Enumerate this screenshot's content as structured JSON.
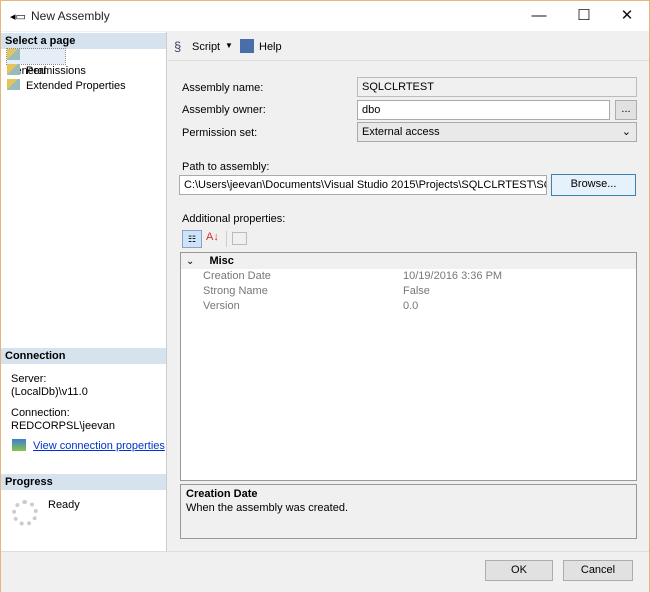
{
  "window": {
    "title": "New Assembly",
    "minimize": "—",
    "maximize": "☐",
    "close": "✕"
  },
  "left": {
    "select_header": "Select a page",
    "pages": [
      {
        "label": "General"
      },
      {
        "label": "Permissions"
      },
      {
        "label": "Extended Properties"
      }
    ],
    "connection_header": "Connection",
    "server_label": "Server:",
    "server_value": "(LocalDb)\\v11.0",
    "connection_label": "Connection:",
    "connection_value": "REDCORPSL\\jeevan",
    "view_link": "View connection properties",
    "progress_header": "Progress",
    "progress_status": "Ready"
  },
  "toolbar": {
    "script": "Script",
    "help": "Help"
  },
  "form": {
    "assembly_name_label": "Assembly name:",
    "assembly_name": "SQLCLRTEST",
    "assembly_owner_label": "Assembly owner:",
    "assembly_owner": "dbo",
    "browse_owner": "...",
    "permission_label": "Permission set:",
    "permission_value": "External access",
    "path_label": "Path to assembly:",
    "path_value": "C:\\Users\\jeevan\\Documents\\Visual Studio 2015\\Projects\\SQLCLRTEST\\SQLCLRTEST\\bin",
    "browse": "Browse...",
    "additional_label": "Additional properties:"
  },
  "grid": {
    "category": "Misc",
    "rows": [
      {
        "name": "Creation Date",
        "value": "10/19/2016 3:36 PM"
      },
      {
        "name": "Strong Name",
        "value": "False"
      },
      {
        "name": "Version",
        "value": "0.0"
      }
    ]
  },
  "description": {
    "title": "Creation Date",
    "text": "When the assembly was created."
  },
  "buttons": {
    "ok": "OK",
    "cancel": "Cancel"
  }
}
